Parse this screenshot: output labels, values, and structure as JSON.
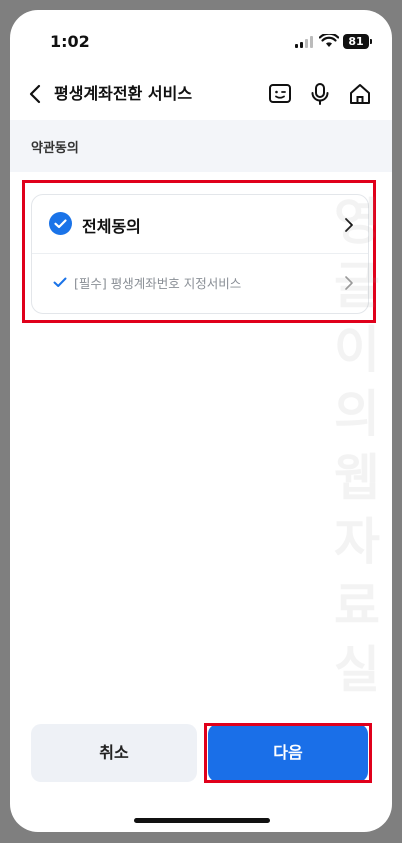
{
  "status_bar": {
    "time": "1:02",
    "battery": "81"
  },
  "nav": {
    "title": "평생계좌전환 서비스"
  },
  "section": {
    "title": "약관동의"
  },
  "terms": {
    "all_label": "전체동의",
    "items": [
      {
        "label": "[필수] 평생계좌번호 지정서비스"
      }
    ]
  },
  "watermark": {
    "text": "영글이의웹자료실"
  },
  "buttons": {
    "cancel": "취소",
    "next": "다음"
  },
  "colors": {
    "accent": "#1a73e8",
    "primary_button": "#1a6fe8",
    "highlight": "#e0001b",
    "section_bg": "#f3f5f9"
  },
  "icons": [
    "back-chevron-icon",
    "chatbot-face-icon",
    "microphone-icon",
    "home-icon",
    "check-circle-icon",
    "checkmark-icon",
    "chevron-right-icon"
  ]
}
